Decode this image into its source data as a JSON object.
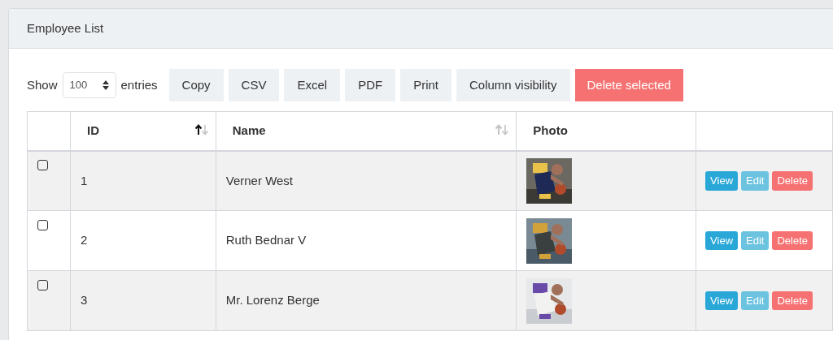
{
  "card": {
    "title": "Employee List"
  },
  "toolbar": {
    "show_label": "Show",
    "page_size": "100",
    "entries_label": "entries",
    "buttons": [
      {
        "label": "Copy",
        "kind": "plain"
      },
      {
        "label": "CSV",
        "kind": "plain"
      },
      {
        "label": "Excel",
        "kind": "plain"
      },
      {
        "label": "PDF",
        "kind": "plain"
      },
      {
        "label": "Print",
        "kind": "plain"
      },
      {
        "label": "Column visibility",
        "kind": "plain"
      },
      {
        "label": "Delete selected",
        "kind": "danger"
      }
    ]
  },
  "table": {
    "columns": [
      {
        "label": "ID",
        "sortable": true,
        "sorted": true
      },
      {
        "label": "Name",
        "sortable": true,
        "sorted": false
      },
      {
        "label": "Photo"
      }
    ],
    "rows": [
      {
        "checked": false,
        "id": "1",
        "name": "Verner West",
        "actions": [
          "View",
          "Edit",
          "Delete"
        ]
      },
      {
        "checked": false,
        "id": "2",
        "name": "Ruth Bednar V",
        "actions": [
          "View",
          "Edit",
          "Delete"
        ]
      },
      {
        "checked": false,
        "id": "3",
        "name": "Mr. Lorenz Berge",
        "actions": [
          "View",
          "Edit",
          "Delete"
        ]
      }
    ]
  }
}
